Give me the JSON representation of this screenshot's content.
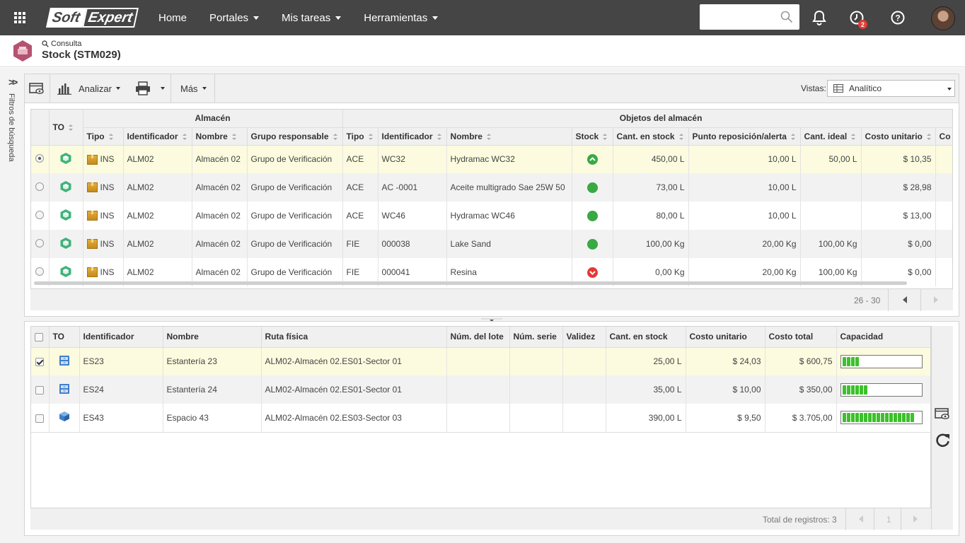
{
  "topbar": {
    "logo_left": "Soft",
    "logo_right": "Expert",
    "nav": [
      {
        "label": "Home",
        "dropdown": false
      },
      {
        "label": "Portales",
        "dropdown": true
      },
      {
        "label": "Mis tareas",
        "dropdown": true
      },
      {
        "label": "Herramientas",
        "dropdown": true
      }
    ],
    "search": {
      "value": "",
      "placeholder": ""
    },
    "notification_badge": "2",
    "icons": [
      "apps-grid-icon",
      "search-icon",
      "bell-icon",
      "clock-icon",
      "help-icon"
    ]
  },
  "page": {
    "breadcrumb": "Consulta",
    "title": "Stock (STM029)"
  },
  "side": {
    "label": "Filtros de búsqueda"
  },
  "toolbar": {
    "analyze_label": "Analizar",
    "more_label": "Más",
    "views_label": "Vistas:",
    "views_value": "Analítico"
  },
  "upper_table": {
    "group_headers": {
      "to": "TO",
      "warehouse": "Almacén",
      "objects": "Objetos del almacén"
    },
    "columns": [
      "Tipo",
      "Identificador",
      "Nombre",
      "Grupo responsable",
      "Tipo",
      "Identificador",
      "Nombre",
      "Stock",
      "Cant. en stock",
      "Punto reposición/alerta",
      "Cant. ideal",
      "Costo unitario",
      "Co"
    ],
    "rows": [
      {
        "selected": true,
        "tipo": "INS",
        "id": "ALM02",
        "nombre": "Almacén 02",
        "grupo": "Grupo de Verificación",
        "obj_tipo": "ACE",
        "obj_id": "WC32",
        "obj_nombre": "Hydramac WC32",
        "stock": "up",
        "cant": "450,00 L",
        "punto": "10,00 L",
        "ideal": "50,00 L",
        "costo": "$ 10,35",
        "extra": "$"
      },
      {
        "selected": false,
        "tipo": "INS",
        "id": "ALM02",
        "nombre": "Almacén 02",
        "grupo": "Grupo de Verificación",
        "obj_tipo": "ACE",
        "obj_id": "AC -0001",
        "obj_nombre": "Aceite multigrado Sae 25W 50",
        "stock": "ok",
        "cant": "73,00 L",
        "punto": "10,00 L",
        "ideal": "",
        "costo": "$ 28,98",
        "extra": "$"
      },
      {
        "selected": false,
        "tipo": "INS",
        "id": "ALM02",
        "nombre": "Almacén 02",
        "grupo": "Grupo de Verificación",
        "obj_tipo": "ACE",
        "obj_id": "WC46",
        "obj_nombre": "Hydramac WC46",
        "stock": "ok",
        "cant": "80,00 L",
        "punto": "10,00 L",
        "ideal": "",
        "costo": "$ 13,00",
        "extra": "$"
      },
      {
        "selected": false,
        "tipo": "INS",
        "id": "ALM02",
        "nombre": "Almacén 02",
        "grupo": "Grupo de Verificación",
        "obj_tipo": "FIE",
        "obj_id": "000038",
        "obj_nombre": "Lake Sand",
        "stock": "ok",
        "cant": "100,00 Kg",
        "punto": "20,00 Kg",
        "ideal": "100,00 Kg",
        "costo": "$ 0,00",
        "extra": ""
      },
      {
        "selected": false,
        "tipo": "INS",
        "id": "ALM02",
        "nombre": "Almacén 02",
        "grupo": "Grupo de Verificación",
        "obj_tipo": "FIE",
        "obj_id": "000041",
        "obj_nombre": "Resina",
        "stock": "down",
        "cant": "0,00 Kg",
        "punto": "20,00 Kg",
        "ideal": "100,00 Kg",
        "costo": "$ 0,00",
        "extra": ""
      }
    ],
    "pager_range": "26 - 30"
  },
  "lower_table": {
    "columns": [
      "TO",
      "Identificador",
      "Nombre",
      "Ruta física",
      "Núm. del lote",
      "Núm. serie",
      "Validez",
      "Cant. en stock",
      "Costo unitario",
      "Costo total",
      "Capacidad"
    ],
    "rows": [
      {
        "checked": true,
        "icon": "shelf-icon",
        "id": "ES23",
        "nombre": "Estantería 23",
        "ruta": "ALM02-Almacén 02.ES01-Sector 01",
        "lote": "",
        "serie": "",
        "validez": "",
        "cant": "25,00 L",
        "costo_u": "$ 24,03",
        "costo_t": "$ 600,75",
        "capacity": 0.2
      },
      {
        "checked": false,
        "icon": "shelf-icon",
        "id": "ES24",
        "nombre": "Estantería 24",
        "ruta": "ALM02-Almacén 02.ES01-Sector 01",
        "lote": "",
        "serie": "",
        "validez": "",
        "cant": "35,00 L",
        "costo_u": "$ 10,00",
        "costo_t": "$ 350,00",
        "capacity": 0.35
      },
      {
        "checked": false,
        "icon": "cube-icon",
        "id": "ES43",
        "nombre": "Espacio 43",
        "ruta": "ALM02-Almacén 02.ES03-Sector 03",
        "lote": "",
        "serie": "",
        "validez": "",
        "cant": "390,00 L",
        "costo_u": "$ 9,50",
        "costo_t": "$ 3.705,00",
        "capacity": 0.93
      }
    ],
    "total_label": "Total de registros: 3",
    "page_number": "1"
  },
  "colors": {
    "topbar": "#454545",
    "stock_ok": "#3aa843",
    "stock_down": "#e53935",
    "capacity": "#3cc12b",
    "selected_row": "#fcfbdf"
  }
}
